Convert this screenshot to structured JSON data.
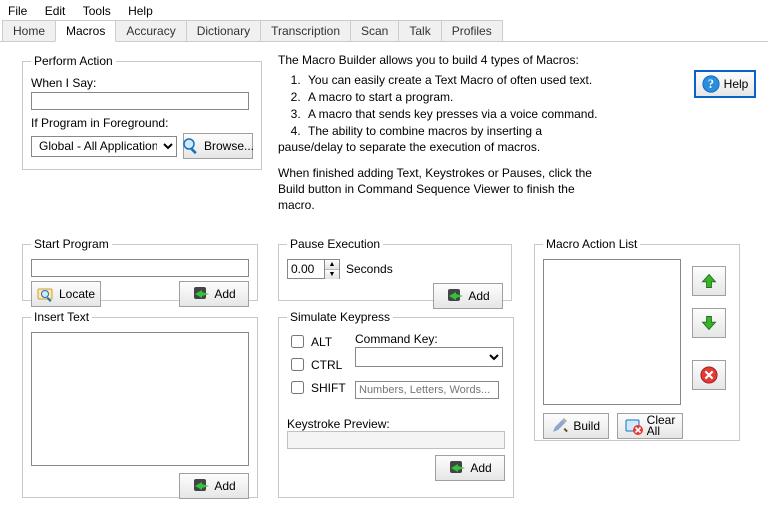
{
  "menubar": {
    "file": "File",
    "edit": "Edit",
    "tools": "Tools",
    "help": "Help"
  },
  "tabs": [
    "Home",
    "Macros",
    "Accuracy",
    "Dictionary",
    "Transcription",
    "Scan",
    "Talk",
    "Profiles"
  ],
  "active_tab_index": 1,
  "help_button": "Help",
  "description": {
    "intro": "The Macro Builder allows you to build 4 types of Macros:",
    "items": [
      "You can easily create a Text Macro of often used text.",
      "A macro to start a program.",
      "A macro that sends key presses via a voice command.",
      "The ability to combine macros by inserting a"
    ],
    "after_list": "pause/delay to separate the execution of macros.",
    "finish1": "When finished adding Text, Keystrokes or Pauses, click the",
    "finish2": "Build button in Command Sequence Viewer to finish the macro."
  },
  "perform_action": {
    "legend": "Perform Action",
    "when_i_say": "When I Say:",
    "say_value": "",
    "if_program": "If Program in Foreground:",
    "program_selected": "Global - All Applications",
    "browse": "Browse..."
  },
  "start_program": {
    "legend": "Start Program",
    "path": "",
    "locate": "Locate",
    "add": "Add"
  },
  "insert_text": {
    "legend": "Insert Text",
    "text": "",
    "add": "Add"
  },
  "pause": {
    "legend": "Pause Execution",
    "value": "0.00",
    "unit": "Seconds",
    "add": "Add"
  },
  "keypress": {
    "legend": "Simulate Keypress",
    "alt": "ALT",
    "ctrl": "CTRL",
    "shift": "SHIFT",
    "command_key_lbl": "Command Key:",
    "command_key": "",
    "nlw_placeholder": "Numbers, Letters, Words...",
    "nlw_value": "",
    "preview_lbl": "Keystroke Preview:",
    "preview": "",
    "add": "Add"
  },
  "action_list": {
    "legend": "Macro Action List",
    "build": "Build",
    "clear_all_l1": "Clear",
    "clear_all_l2": "All"
  }
}
